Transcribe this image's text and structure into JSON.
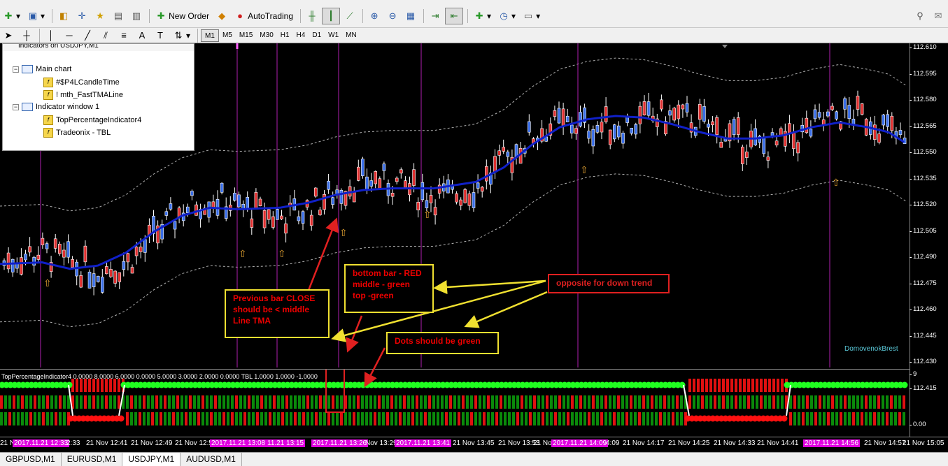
{
  "toolbar": {
    "new_order_label": "New Order",
    "autotrading_label": "AutoTrading",
    "timeframes": [
      "M1",
      "M5",
      "M15",
      "M30",
      "H1",
      "H4",
      "D1",
      "W1",
      "MN"
    ],
    "active_timeframe": "M1",
    "drawing_text_tool": "A"
  },
  "navigator": {
    "title": "Indicators on USDJPY,M1",
    "main_chart": "Main chart",
    "main_items": [
      "#$P4LCandleTime",
      "!   mth_FastTMALine"
    ],
    "indicator_window": "Indicator window 1",
    "window_items": [
      "TopPercentageIndicator4",
      "Tradeonix - TBL"
    ]
  },
  "price_axis": [
    "112.610",
    "112.595",
    "112.580",
    "112.565",
    "112.550",
    "112.535",
    "112.520",
    "112.505",
    "112.490",
    "112.475",
    "112.460",
    "112.445",
    "112.430",
    "112.415"
  ],
  "indicator_axis": {
    "top": "9",
    "bottom": "0.00"
  },
  "time_axis": [
    {
      "text": "21 No",
      "mag": false
    },
    {
      "text": "2017.11.21 12:33",
      "mag": true
    },
    {
      "text": "2:33",
      "mag": false
    },
    {
      "text": "21 Nov 12:41",
      "mag": false
    },
    {
      "text": "21 Nov 12:49",
      "mag": false
    },
    {
      "text": "21 Nov 12:5",
      "mag": false
    },
    {
      "text": "2017.11.21 13:08",
      "mag": true
    },
    {
      "text": "11.21 13:15",
      "mag": true
    },
    {
      "text": "2017.11.21 13:26",
      "mag": true
    },
    {
      "text": "Nov 13:29",
      "mag": false
    },
    {
      "text": "2017.11.21 13:41",
      "mag": true
    },
    {
      "text": "21 Nov 13:45",
      "mag": false
    },
    {
      "text": "21 Nov 13:53",
      "mag": false
    },
    {
      "text": "21 No",
      "mag": false
    },
    {
      "text": "2017.11.21 14:09",
      "mag": true
    },
    {
      "text": "4:09",
      "mag": false
    },
    {
      "text": "21 Nov 14:17",
      "mag": false
    },
    {
      "text": "21 Nov 14:25",
      "mag": false
    },
    {
      "text": "21 Nov 14:33",
      "mag": false
    },
    {
      "text": "21 Nov 14:41",
      "mag": false
    },
    {
      "text": "2017.11.21 14:56",
      "mag": true
    },
    {
      "text": "21 Nov 14:57",
      "mag": false
    },
    {
      "text": "21 Nov 15:05",
      "mag": false
    }
  ],
  "indicator_label": "TopPercentageIndicator4 0.0000 8.0000 6.0000 0.0000 5.0000 3.0000 2.0000 0.0000  TBL 1.0000 1.0000 -1.0000",
  "watermark": "DomovenokBrest",
  "annotations": {
    "prev_bar": "Previous bar CLOSE\nshould be < middle\nLine TMA",
    "bars": "bottom bar - RED\nmiddle - green\ntop  -green",
    "opposite": "opposite for down trend",
    "dots": "Dots should be green"
  },
  "tabs": [
    "GBPUSD,M1",
    "EURUSD,M1",
    "USDJPY,M1",
    "AUDUSD,M1"
  ],
  "active_tab": "USDJPY,M1",
  "colors": {
    "bull_candle": "#3a6ee8",
    "bear_candle": "#e03030",
    "tma_line": "#1020c8",
    "band": "#b0b0b0",
    "vline": "#b020b0",
    "dot": "#20ff20",
    "bar_green": "#0a8a0a",
    "bar_red": "#e01010"
  }
}
